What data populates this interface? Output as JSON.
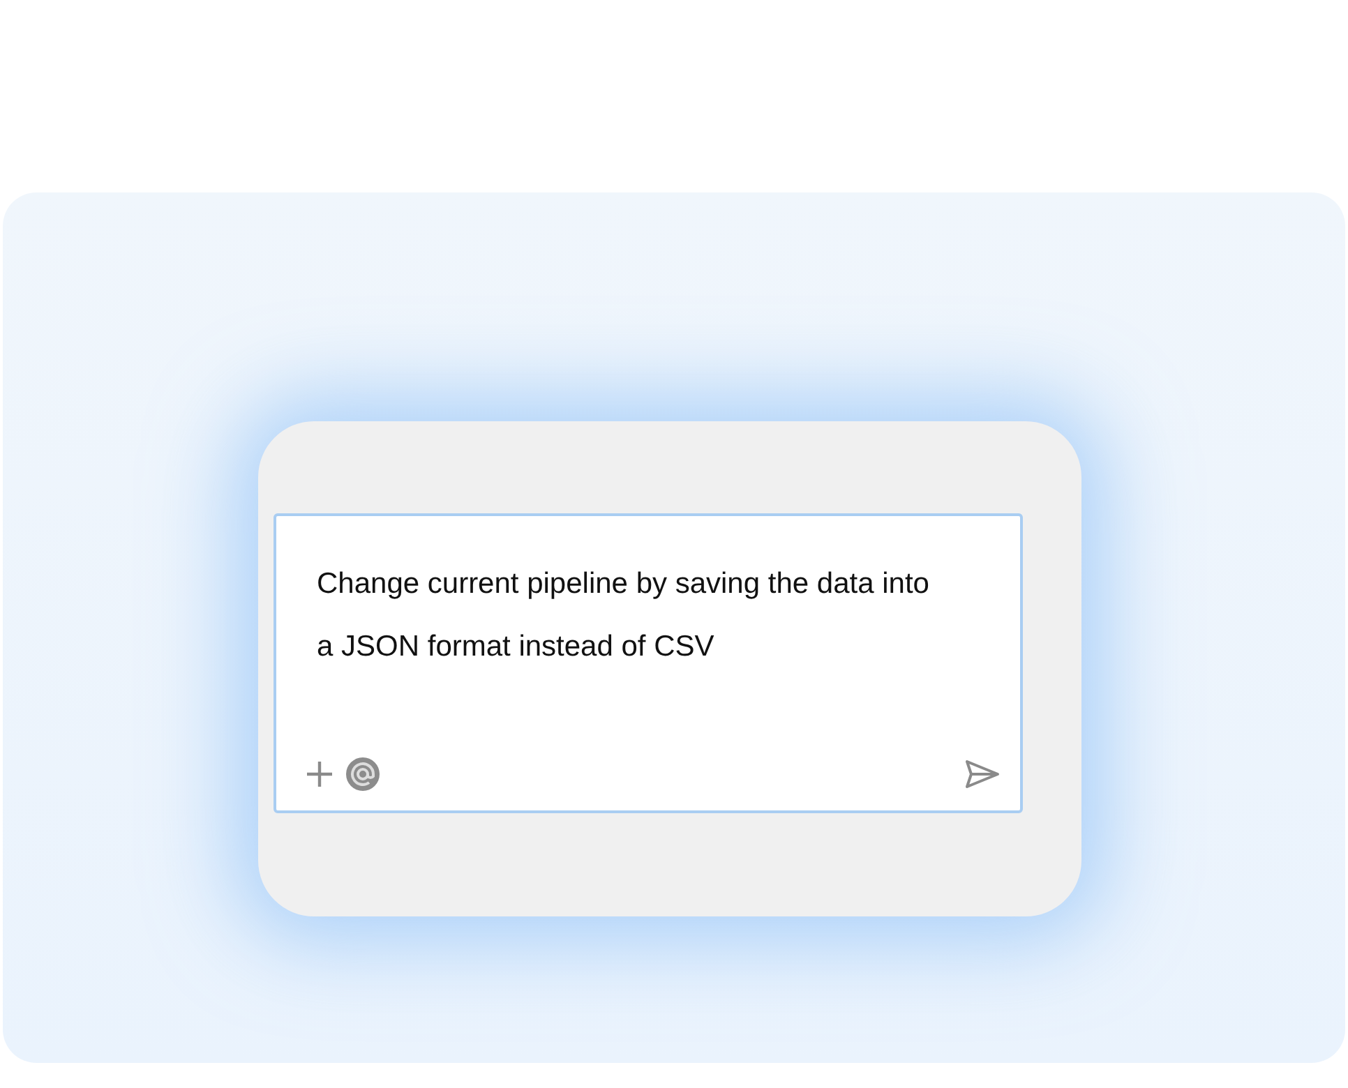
{
  "prompt_box": {
    "value": "Change current pipeline by saving the data into a JSON format instead of CSV"
  }
}
